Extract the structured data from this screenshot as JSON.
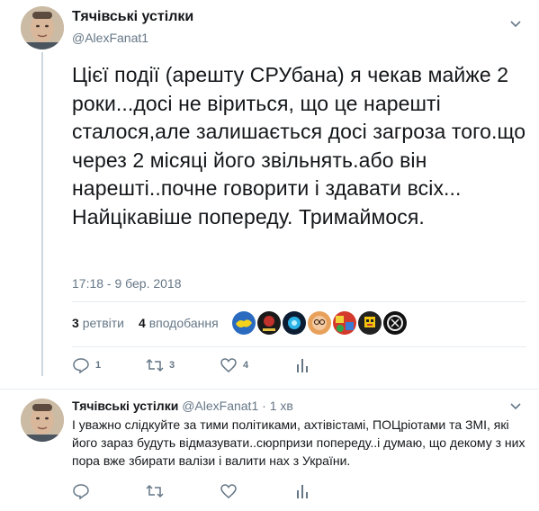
{
  "tweet": {
    "author_name": "Тячівські устілки",
    "author_handle": "@AlexFanat1",
    "text": "Цієї події (арешту СРУбана) я чекав майже 2 роки...досі не віриться, що це нарешті сталося,але залишається досі загроза того.що через 2 місяці його звільнять.або він нарешті..почне говорити і здавати всіх... Найцікавіше попереду. Тримаймося.",
    "timestamp": "17:18 - 9 бер. 2018",
    "retweets_count": "3",
    "retweets_label": "ретвіти",
    "likes_count": "4",
    "likes_label": "вподобання",
    "likers": [
      "ukraine-map-avatar",
      "red-emblem-avatar",
      "blue-glow-avatar",
      "face-with-glasses-avatar",
      "colorful-collage-avatar",
      "pixel-art-avatar",
      "dark-logo-avatar"
    ],
    "actions": {
      "reply_count": "1",
      "retweet_count": "3",
      "like_count": "4"
    }
  },
  "reply": {
    "author_name": "Тячівські устілки",
    "author_handle": "@AlexFanat1",
    "separator": "·",
    "time_ago": "1 хв",
    "text": "І уважно слідкуйте за тими політиками, ахтівістамі, ПОЦріотами та ЗМІ, які його зараз будуть відмазувати..сюрпризи попереду..і думаю, що декому з них пора вже збирати валізи і валити нах з України."
  },
  "colors": {
    "text_primary": "#14171a",
    "text_secondary": "#657786",
    "divider": "#e6ecf0",
    "thread_line": "#ccd6dd"
  }
}
